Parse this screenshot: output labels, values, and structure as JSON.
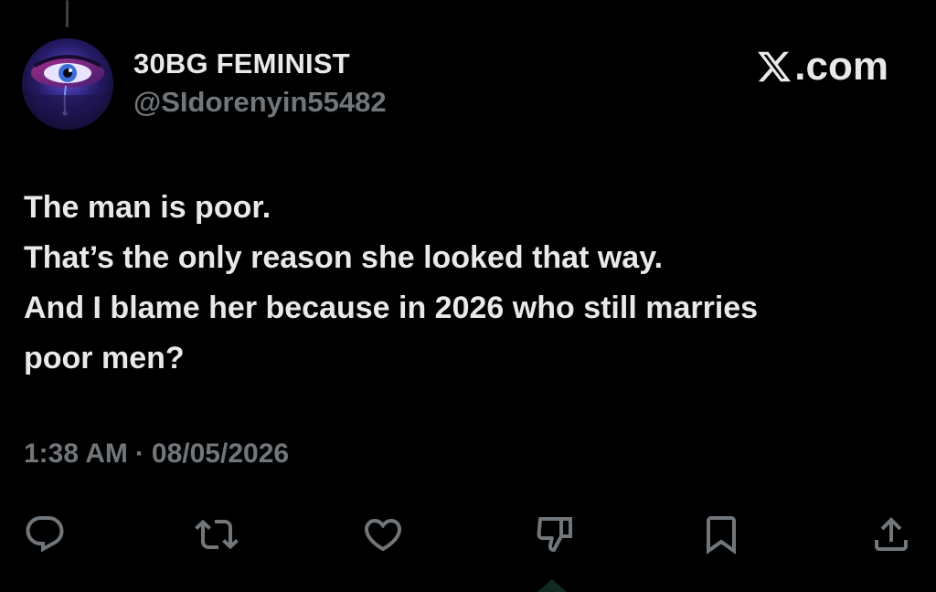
{
  "author": {
    "display_name": "30BG FEMINIST",
    "handle": "@SIdorenyin55482"
  },
  "brand": {
    "label": ".com"
  },
  "tweet": {
    "lines": [
      "The man is poor.",
      "That’s the only reason she looked that way.",
      "And I blame her because in 2026 who still marries",
      "poor men?"
    ],
    "time": "1:38 AM",
    "separator": "·",
    "date": "08/05/2026"
  },
  "actions": [
    {
      "name": "reply",
      "icon": "reply-icon"
    },
    {
      "name": "retweet",
      "icon": "retweet-icon"
    },
    {
      "name": "like",
      "icon": "heart-icon"
    },
    {
      "name": "downvote",
      "icon": "thumbs-down-icon"
    },
    {
      "name": "bookmark",
      "icon": "bookmark-icon"
    },
    {
      "name": "share",
      "icon": "share-icon"
    }
  ],
  "colors": {
    "background": "#000000",
    "primary_text": "#e7e9ea",
    "secondary_text": "#71767b"
  }
}
